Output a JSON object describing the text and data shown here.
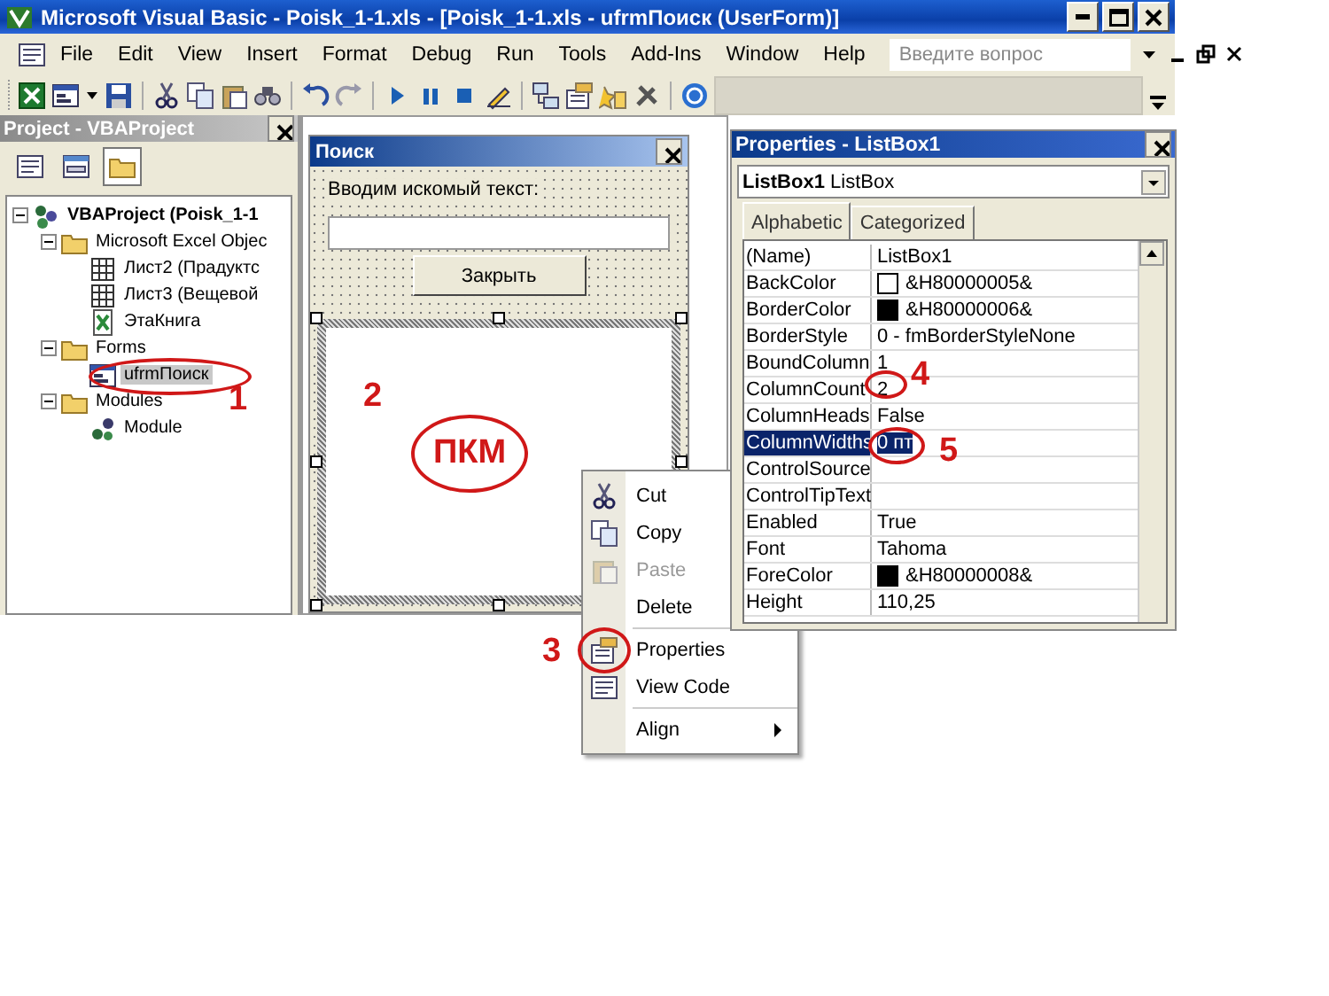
{
  "window": {
    "title": "Microsoft Visual Basic - Poisk_1-1.xls - [Poisk_1-1.xls - ufrmПоиск (UserForm)]"
  },
  "menu": [
    "File",
    "Edit",
    "View",
    "Insert",
    "Format",
    "Debug",
    "Run",
    "Tools",
    "Add-Ins",
    "Window",
    "Help"
  ],
  "help_search": {
    "placeholder": "Введите вопрос"
  },
  "project": {
    "title": "Project - VBAProject",
    "tree": [
      {
        "label": "VBAProject (Poisk_1-1",
        "kind": "project",
        "expanded": true,
        "selected": false,
        "children": [
          {
            "label": "Microsoft Excel Objec",
            "kind": "folder",
            "expanded": true,
            "selected": false,
            "children": [
              {
                "label": "Лист2 (Прадуктс",
                "kind": "sheet",
                "selected": false
              },
              {
                "label": "Лист3 (Вещевой",
                "kind": "sheet",
                "selected": false
              },
              {
                "label": "ЭтаКнига",
                "kind": "workbook",
                "selected": false
              }
            ]
          },
          {
            "label": "Forms",
            "kind": "folder",
            "expanded": true,
            "selected": false,
            "children": [
              {
                "label": "ufrmПоиск",
                "kind": "form",
                "selected": true
              }
            ]
          },
          {
            "label": "Modules",
            "kind": "folder",
            "expanded": true,
            "selected": false,
            "children": [
              {
                "label": "Module",
                "kind": "module",
                "selected": false
              }
            ]
          }
        ]
      }
    ]
  },
  "form": {
    "title": "Поиск",
    "label": "Вводим искомый текст:",
    "button": "Закрыть"
  },
  "context_menu": {
    "groups": [
      [
        {
          "label": "Cut",
          "kind": "cut",
          "disabled": false
        },
        {
          "label": "Copy",
          "kind": "copy",
          "disabled": false
        },
        {
          "label": "Paste",
          "kind": "paste",
          "disabled": true
        },
        {
          "label": "Delete",
          "kind": "plain",
          "disabled": false
        }
      ],
      [
        {
          "label": "Properties",
          "kind": "properties",
          "disabled": false
        },
        {
          "label": "View Code",
          "kind": "code",
          "disabled": false
        }
      ],
      [
        {
          "label": "Align",
          "kind": "submenu",
          "disabled": false
        }
      ]
    ]
  },
  "properties": {
    "title": "Properties - ListBox1",
    "object": "**ListBox1** ListBox",
    "tabs": [
      {
        "label": "Alphabetic",
        "selected": true
      },
      {
        "label": "Categorized",
        "selected": false
      }
    ],
    "rows": [
      {
        "name": "(Name)",
        "value": "ListBox1",
        "selected": false
      },
      {
        "name": "BackColor",
        "value": "&H80000005&",
        "color": "#ffffff",
        "selected": false
      },
      {
        "name": "BorderColor",
        "value": "&H80000006&",
        "color": "#000000",
        "selected": false
      },
      {
        "name": "BorderStyle",
        "value": "0 - fmBorderStyleNone",
        "selected": false
      },
      {
        "name": "BoundColumn",
        "value": "1",
        "selected": false
      },
      {
        "name": "ColumnCount",
        "value": "2",
        "selected": false
      },
      {
        "name": "ColumnHeads",
        "value": "False",
        "selected": false
      },
      {
        "name": "ColumnWidths",
        "value": "0 пт",
        "selected": true
      },
      {
        "name": "ControlSource",
        "selected": false
      },
      {
        "name": "ControlTipText",
        "selected": false
      },
      {
        "name": "Enabled",
        "value": "True",
        "selected": false
      },
      {
        "name": "Font",
        "value": "Tahoma",
        "selected": false
      },
      {
        "name": "ForeColor",
        "value": "&H80000008&",
        "color": "#000000",
        "selected": false
      },
      {
        "name": "Height",
        "value": "110,25",
        "selected": false
      }
    ]
  },
  "annotations": [
    {
      "kind": "ellipse"
    },
    {
      "kind": "number",
      "text": "1"
    },
    {
      "kind": "number",
      "text": "2"
    },
    {
      "kind": "circled",
      "text": "ПКМ"
    },
    {
      "kind": "number",
      "text": "3"
    },
    {
      "kind": "ellipse"
    },
    {
      "kind": "ellipse"
    },
    {
      "kind": "number",
      "text": "4"
    },
    {
      "kind": "ellipse"
    },
    {
      "kind": "number",
      "text": "5"
    }
  ]
}
